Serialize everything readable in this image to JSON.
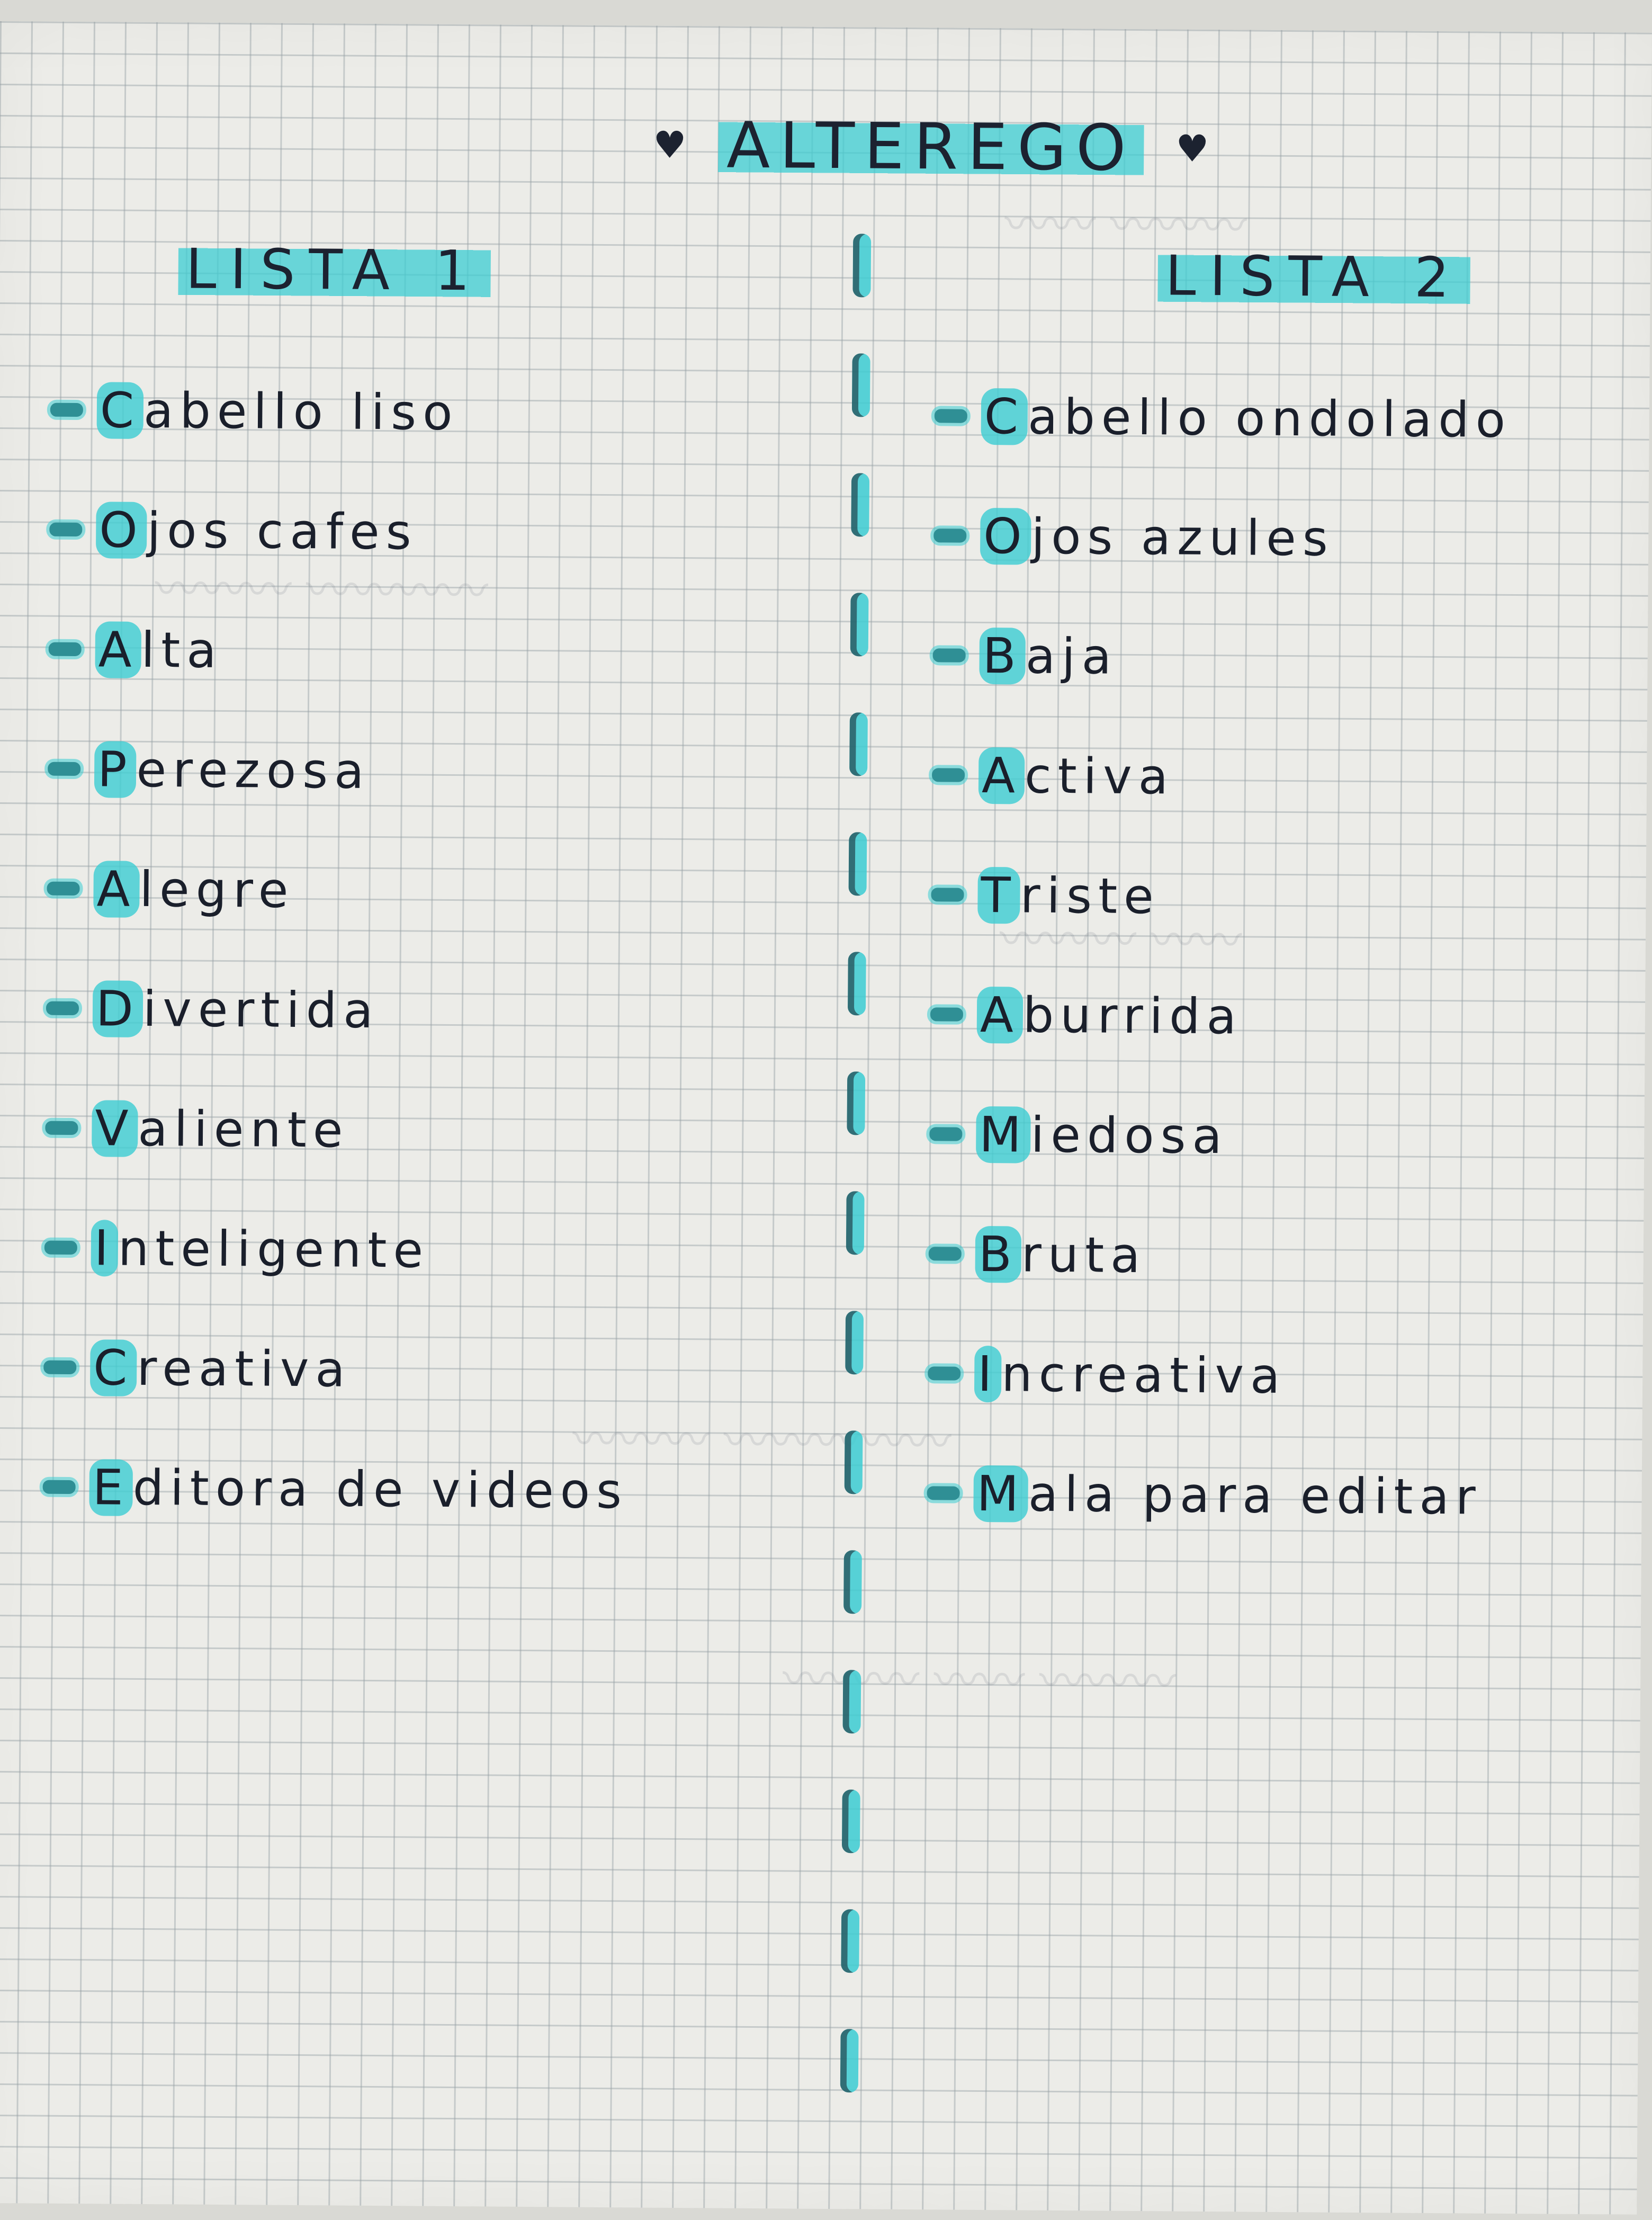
{
  "title": "ALTEREGO",
  "decorations": {
    "heart_glyph": "♥",
    "accent_color": "#3ccdd2",
    "ink_color": "#1c2230",
    "paper_color": "#ecece8"
  },
  "lists": {
    "left": {
      "heading": "LISTA 1",
      "items": [
        "Cabello liso",
        "Ojos cafes",
        "Alta",
        "Perezosa",
        "Alegre",
        "Divertida",
        "Valiente",
        "Inteligente",
        "Creativa",
        "Editora de videos"
      ]
    },
    "right": {
      "heading": "LISTA 2",
      "items": [
        "Cabello ondolado",
        "Ojos azules",
        "Baja",
        "Activa",
        "Triste",
        "Aburrida",
        "Miedosa",
        "Bruta",
        "Increativa",
        "Mala para editar"
      ]
    }
  }
}
